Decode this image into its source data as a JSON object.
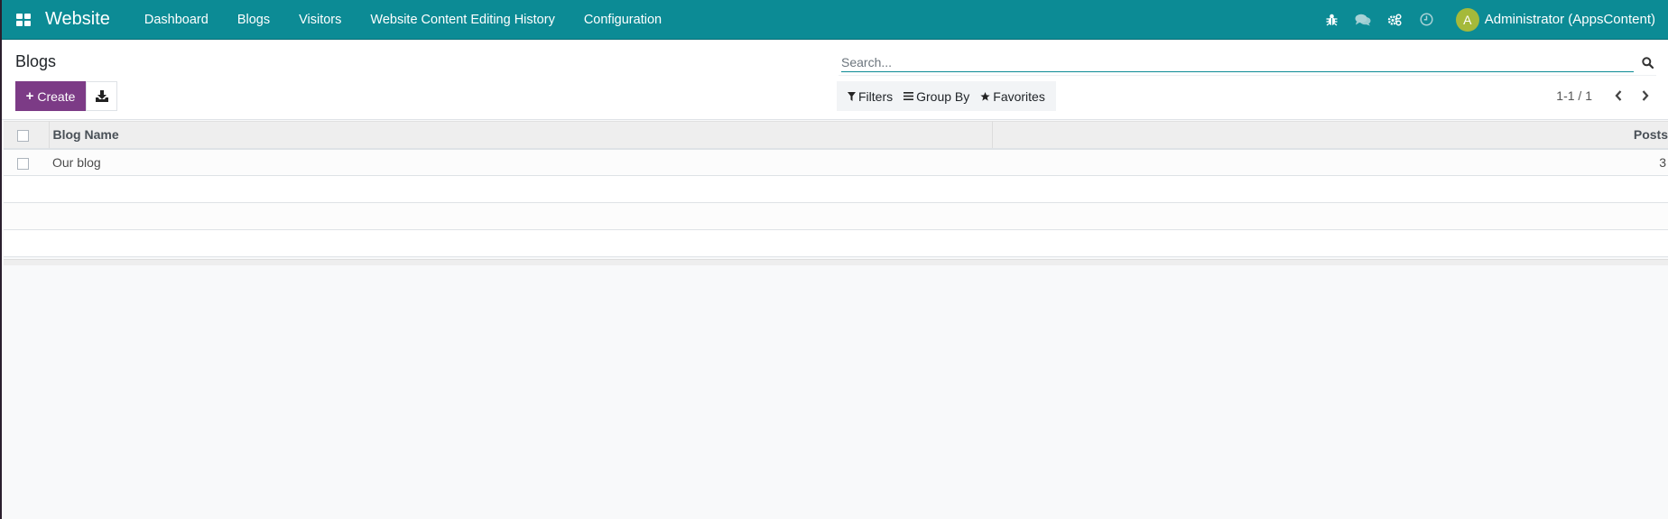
{
  "navbar": {
    "app_name": "Website",
    "menu": [
      {
        "label": "Dashboard"
      },
      {
        "label": "Blogs"
      },
      {
        "label": "Visitors"
      },
      {
        "label": "Website Content Editing History"
      },
      {
        "label": "Configuration"
      }
    ],
    "systray": [
      {
        "icon": "bug-icon"
      },
      {
        "icon": "chat-icon"
      },
      {
        "icon": "cogs-icon"
      },
      {
        "icon": "clock-icon"
      }
    ],
    "user": {
      "avatar_letter": "A",
      "avatar_color": "#a5b93a",
      "name": "Administrator (AppsContent)"
    },
    "color": "#0c8b95"
  },
  "control_panel": {
    "title": "Blogs",
    "create_label": "Create",
    "create_color": "#7c3b86",
    "search": {
      "placeholder": "Search...",
      "value": ""
    },
    "filters": [
      {
        "label": "Filters",
        "icon": "filter-icon"
      },
      {
        "label": "Group By",
        "icon": "bars-icon"
      },
      {
        "label": "Favorites",
        "icon": "star-icon"
      }
    ],
    "pager": {
      "value": "1-1 / 1"
    }
  },
  "table": {
    "columns": [
      "Blog Name",
      "Posts"
    ],
    "rows": [
      {
        "name": "Our blog",
        "posts": "3"
      }
    ]
  }
}
